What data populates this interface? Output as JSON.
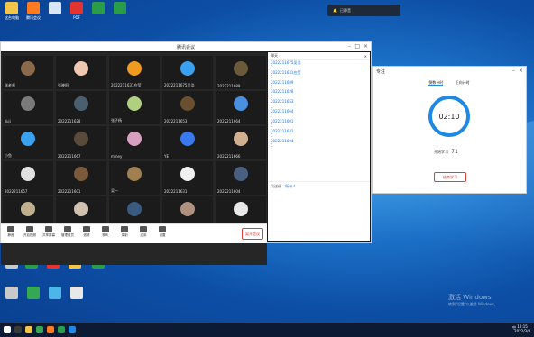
{
  "desktop": {
    "icons_top": [
      {
        "label": "这台电脑",
        "color": "#f3c54b"
      },
      {
        "label": "腾讯会议",
        "color": "#ff7a20"
      },
      {
        "label": "",
        "color": "#d9e6f7"
      },
      {
        "label": "PDF",
        "color": "#e3342f"
      },
      {
        "label": "",
        "color": "#2a9d4a"
      },
      {
        "label": "",
        "color": "#2a9d4a"
      }
    ],
    "icons_mid": [
      {
        "label": "",
        "color": "#c9c9c9"
      },
      {
        "label": "",
        "color": "#2a9d4a"
      },
      {
        "label": "",
        "color": "#e3342f"
      },
      {
        "label": "",
        "color": "#f3c54b"
      },
      {
        "label": "",
        "color": "#2a9d4a"
      }
    ],
    "icons_bottom": [
      {
        "label": "",
        "color": "#c9c9c9"
      },
      {
        "label": "",
        "color": "#34a853"
      },
      {
        "label": "",
        "color": "#4db6e8"
      },
      {
        "label": "",
        "color": "#e8e8e8"
      }
    ],
    "notification": "已静音"
  },
  "meeting": {
    "title": "腾讯会议",
    "tiles": [
      {
        "name": "张老师",
        "color": "#8a6a4a"
      },
      {
        "name": "张晓阳",
        "color": "#f0c8b0"
      },
      {
        "name": "2022211631应莹",
        "color": "#f09a20"
      },
      {
        "name": "2022211675吴浩",
        "color": "#3aa0f0"
      },
      {
        "name": "2022211689",
        "color": "#6b5a3a"
      },
      {
        "name": "Yuji",
        "color": "#7a7a7a"
      },
      {
        "name": "2022211628",
        "color": "#4a6070"
      },
      {
        "name": "张子杨",
        "color": "#b0d080"
      },
      {
        "name": "2022211653",
        "color": "#6a5030"
      },
      {
        "name": "2022211664",
        "color": "#4a90e0"
      },
      {
        "name": "小鱼",
        "color": "#3aa0f0"
      },
      {
        "name": "2022211667",
        "color": "#5a4a3a"
      },
      {
        "name": "miney",
        "color": "#d8a0c0"
      },
      {
        "name": "YE",
        "color": "#3a78f0"
      },
      {
        "name": "2022211666",
        "color": "#d0b090"
      },
      {
        "name": "2022211657",
        "color": "#e0e0e0"
      },
      {
        "name": "2022211601",
        "color": "#7a5a3a"
      },
      {
        "name": "吴一",
        "color": "#a08050"
      },
      {
        "name": "2022211631",
        "color": "#f0f0f0"
      },
      {
        "name": "2022211604",
        "color": "#4a6080"
      },
      {
        "name": "",
        "color": "#c0b090"
      },
      {
        "name": "",
        "color": "#d0c0b0"
      },
      {
        "name": "",
        "color": "#3a5a80"
      },
      {
        "name": "",
        "color": "#b09080"
      },
      {
        "name": "",
        "color": "#e8e8e8"
      }
    ],
    "toolbar": [
      "静音",
      "开启视频",
      "共享屏幕",
      "管理成员",
      "邀请",
      "聊天",
      "录制",
      "应用",
      "设置"
    ],
    "leave": "离开会议",
    "chat": {
      "title": "聊天",
      "messages": [
        {
          "text": "2022211675吴浩",
          "blue": true
        },
        {
          "text": "1",
          "blue": false
        },
        {
          "text": "2022211631应莹",
          "blue": true
        },
        {
          "text": "1",
          "blue": false
        },
        {
          "text": "2022211689",
          "blue": true
        },
        {
          "text": "1",
          "blue": false
        },
        {
          "text": "2022211628",
          "blue": true
        },
        {
          "text": "1",
          "blue": false
        },
        {
          "text": "2022211653",
          "blue": true
        },
        {
          "text": "1",
          "blue": false
        },
        {
          "text": "2022211664",
          "blue": true
        },
        {
          "text": "1",
          "blue": false
        },
        {
          "text": "2022211601",
          "blue": true
        },
        {
          "text": "1",
          "blue": false
        },
        {
          "text": "2022211631",
          "blue": true
        },
        {
          "text": "1",
          "blue": false
        },
        {
          "text": "2022211604",
          "blue": true
        },
        {
          "text": "1",
          "blue": false
        }
      ],
      "send_to_label": "发送给",
      "send_to_value": "所有人"
    }
  },
  "timer": {
    "title": "专注",
    "tabs": [
      "倒数计时",
      "正向计时"
    ],
    "time": "02:10",
    "progress": 0.85,
    "study_label": "开始学习",
    "stat": "71",
    "study_button": "结束学习"
  },
  "taskbar": {
    "clock_time": "10:15",
    "clock_date": "2022/3/8",
    "tray": "中"
  },
  "watermark": {
    "line1": "激活 Windows",
    "line2": "转到\"设置\"以激活 Windows。"
  }
}
